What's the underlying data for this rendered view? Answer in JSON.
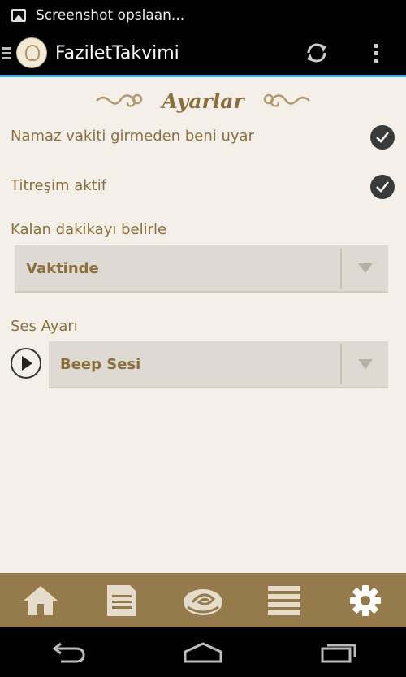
{
  "status_bar": {
    "notification_text": "Screenshot opslaan..."
  },
  "action_bar": {
    "app_title": "FaziletTakvimi"
  },
  "page": {
    "heading": "Ayarlar",
    "pref_warn_label": "Namaz vakiti girmeden beni uyar",
    "pref_warn_checked": true,
    "pref_vibration_label": "Titreşim aktif",
    "pref_vibration_checked": true,
    "minutes_label": "Kalan dakikayı belirle",
    "minutes_selected": "Vaktinde",
    "sound_label": "Ses Ayarı",
    "sound_selected": "Beep Sesi"
  },
  "bottom_nav": {
    "items": [
      "home-icon",
      "document-icon",
      "rose-icon",
      "menu-lines-icon",
      "gear-icon"
    ],
    "active": "gear-icon"
  },
  "colors": {
    "accent_text": "#8b6f3c",
    "nav_bar": "#957a4c",
    "background": "#f4efe9",
    "actionbar_underline": "#33b5e5"
  }
}
